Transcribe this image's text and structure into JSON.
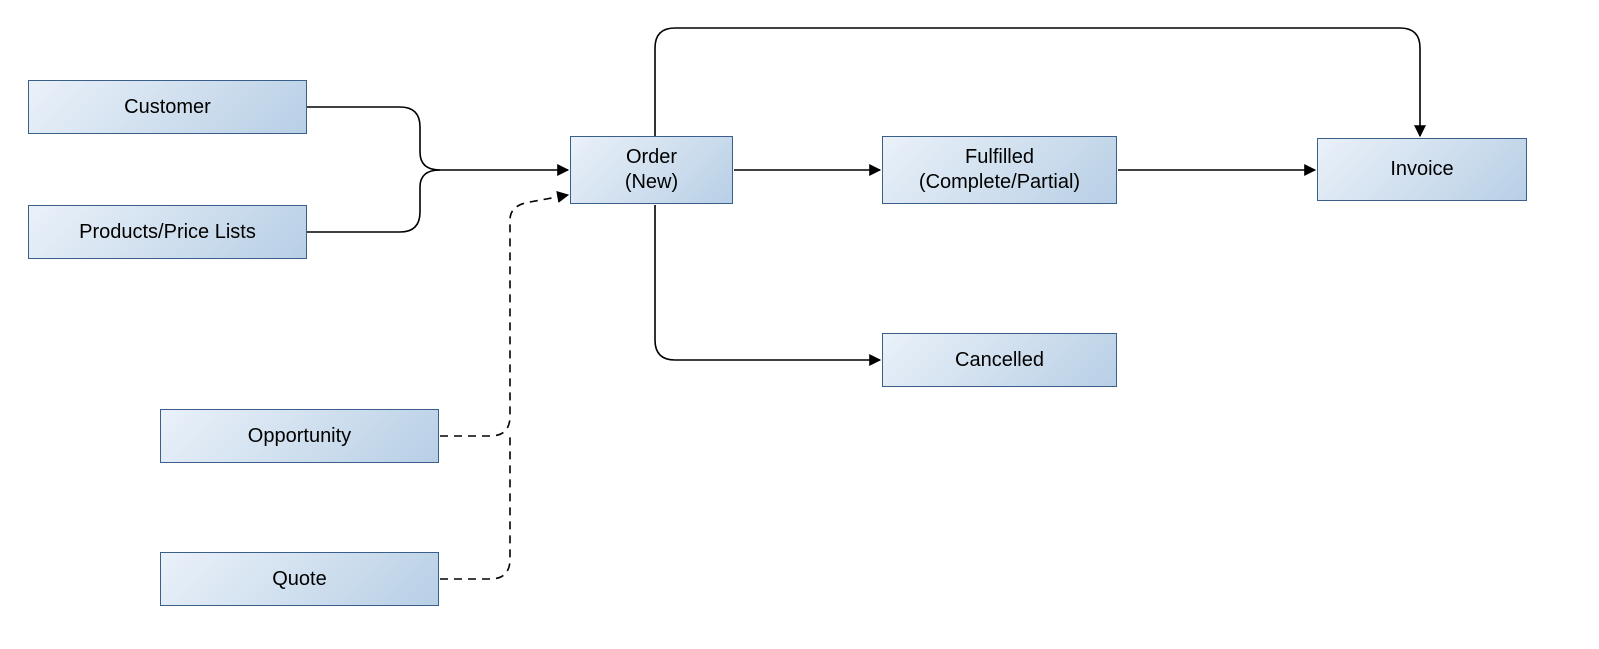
{
  "nodes": {
    "customer": "Customer",
    "products": "Products/Price Lists",
    "opportunity": "Opportunity",
    "quote": "Quote",
    "order_l1": "Order",
    "order_l2": "(New)",
    "fulfilled_l1": "Fulfilled",
    "fulfilled_l2": "(Complete/Partial)",
    "cancelled": "Cancelled",
    "invoice": "Invoice"
  }
}
